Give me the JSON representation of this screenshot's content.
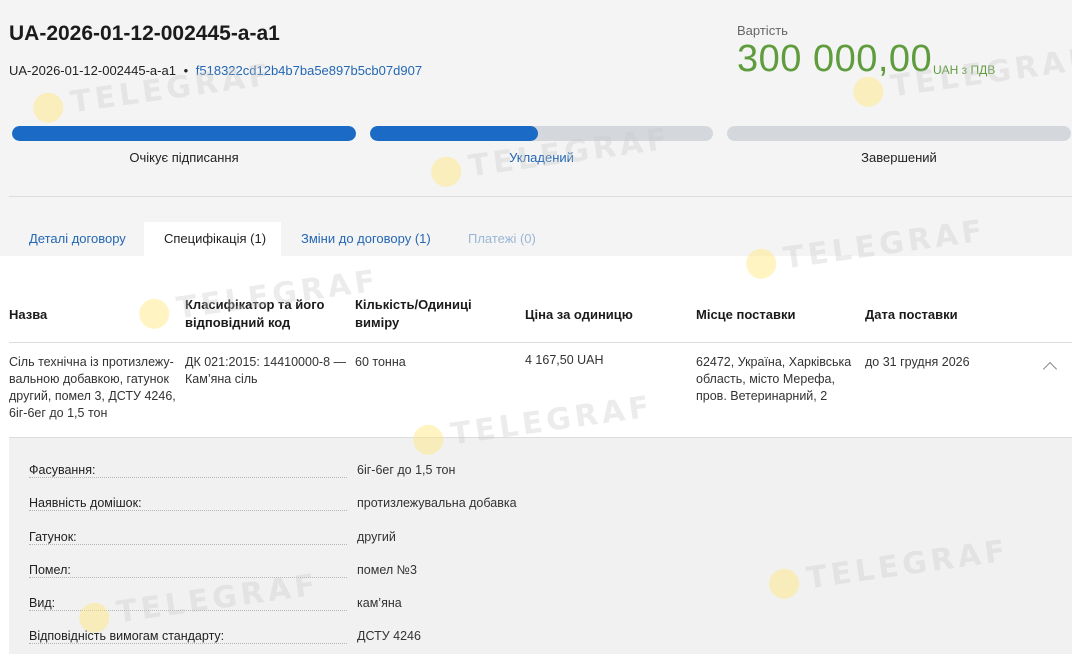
{
  "header": {
    "title": "UA-2026-01-12-002445-a-a1",
    "contract_id": "UA-2026-01-12-002445-a-a1",
    "separator": "•",
    "hash": "f518322cd12b4b7ba5e897b5cb07d907"
  },
  "cost": {
    "label": "Вартість",
    "value": "300 000,00",
    "currency_note": "UAH з ПДВ"
  },
  "progress": {
    "steps": [
      {
        "label": "Очікує підписання",
        "fill": 1.0
      },
      {
        "label": "Укладений",
        "fill": 0.49
      },
      {
        "label": "Завершений",
        "fill": 0.0
      }
    ]
  },
  "tabs": [
    {
      "label": "Деталі договору"
    },
    {
      "label": "Специфікація (1)"
    },
    {
      "label": "Зміни до договору (1)"
    },
    {
      "label": "Платежі (0)"
    }
  ],
  "table": {
    "headers": [
      "Назва",
      "Класифікатор та його відповідний код",
      "Кількість/Одиниці виміру",
      "Ціна за одиницю",
      "Місце поставки",
      "Дата поставки"
    ],
    "row": {
      "name": "Сіль технічна із протизлежу-вальною добавкою, гатунок другий, помел 3, ДСТУ 4246, 6іг-6ег до 1,5 тон",
      "classifier": "ДК 021:2015: 14410000-8 — Кам’яна сіль",
      "quantity": "60 тонна",
      "price": "4 167,50 UAH",
      "place": "62472, Україна, Харківська область, місто Мерефа, пров. Ветеринарний, 2",
      "date": "до 31 грудня 2026"
    }
  },
  "details": [
    {
      "label": "Фасування:",
      "value": "6іг-6ег до 1,5 тон"
    },
    {
      "label": "Наявність домішок:",
      "value": "протизлежувальна добавка"
    },
    {
      "label": "Гатунок:",
      "value": "другий"
    },
    {
      "label": "Помел:",
      "value": "помел №3"
    },
    {
      "label": "Вид:",
      "value": "кам’яна"
    },
    {
      "label": "Відповідність вимогам стандарту:",
      "value": "ДСТУ 4246"
    }
  ],
  "watermark": "TELEGRAF",
  "colors": {
    "accent_blue": "#1a6ac6",
    "link_blue": "#2467b3",
    "price_green": "#5f9c3d"
  }
}
